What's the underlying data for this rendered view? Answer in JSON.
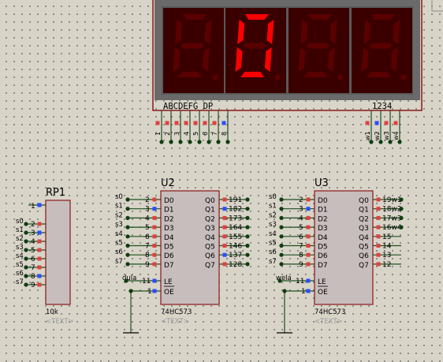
{
  "colors": {
    "canvas": "#d8d4c8",
    "chip_fill": "#c8bdbd",
    "chip_border": "#8a1818",
    "wire": "#1e4f1e",
    "junction": "#0f3d0f",
    "display_body": "#6a6a6a",
    "digit_bg": "#3a0000",
    "segment_off": "#5a0000",
    "segment_on": "#ff0000",
    "pin_red": "#e04040",
    "pin_blue": "#2c4cff"
  },
  "display": {
    "segment_label": "ABCDEFG  DP",
    "digit_label": "1234",
    "seg_pins": [
      "1",
      "2",
      "3",
      "4",
      "5",
      "6",
      "7",
      "8"
    ],
    "com_pins": [
      "w1",
      "w2",
      "w3",
      "w4"
    ],
    "digits": [
      "8",
      "0",
      "8",
      "8"
    ],
    "lit_digit": 1
  },
  "rp1": {
    "title": "RP1",
    "common_pin": "1",
    "pins": [
      "2",
      "3",
      "4",
      "5",
      "6",
      "7",
      "8",
      "9"
    ],
    "nets": [
      "s0",
      "s1",
      "s2",
      "s3",
      "s4",
      "s5",
      "s6",
      "s7"
    ],
    "value": "10k",
    "text_placeholder": "<TEXT>"
  },
  "u2": {
    "title": "U2",
    "part": "74HC573",
    "text_placeholder": "<TEXT>",
    "d_pins": [
      "2",
      "3",
      "4",
      "5",
      "6",
      "7",
      "8",
      "9"
    ],
    "d_labels": [
      "D0",
      "D1",
      "D2",
      "D3",
      "D4",
      "D5",
      "D6",
      "D7"
    ],
    "q_labels": [
      "Q0",
      "Q1",
      "Q2",
      "Q3",
      "Q4",
      "Q5",
      "Q6",
      "Q7"
    ],
    "q_pins": [
      "19",
      "18",
      "17",
      "16",
      "15",
      "14",
      "13",
      "12"
    ],
    "q_nets": [
      "1",
      "2",
      "3",
      "4",
      "5",
      "6",
      "7",
      "8"
    ],
    "in_nets": [
      "s0",
      "s1",
      "s2",
      "s3",
      "s4",
      "s5",
      "s6",
      "s7"
    ],
    "le_label": "LE",
    "oe_label": "OE",
    "le_pin": "11",
    "oe_pin": "1",
    "le_net": "dula"
  },
  "u3": {
    "title": "U3",
    "part": "74HC573",
    "text_placeholder": "<TEXT>",
    "d_pins": [
      "2",
      "3",
      "4",
      "5",
      "6",
      "7",
      "8",
      "9"
    ],
    "d_labels": [
      "D0",
      "D1",
      "D2",
      "D3",
      "D4",
      "D5",
      "D6",
      "D7"
    ],
    "q_labels": [
      "Q0",
      "Q1",
      "Q2",
      "Q3",
      "Q4",
      "Q5",
      "Q6",
      "Q7"
    ],
    "q_pins": [
      "19",
      "18",
      "17",
      "16",
      "15",
      "14",
      "13",
      "12"
    ],
    "q_nets": [
      "w1",
      "w2",
      "w3",
      "w4",
      "",
      "",
      "",
      ""
    ],
    "in_nets": [
      "s0",
      "s1",
      "s2",
      "s3",
      "s4",
      "s5",
      "s6",
      "s7"
    ],
    "le_label": "LE",
    "oe_label": "OE",
    "le_pin": "11",
    "oe_pin": "1",
    "le_net": "wela"
  }
}
